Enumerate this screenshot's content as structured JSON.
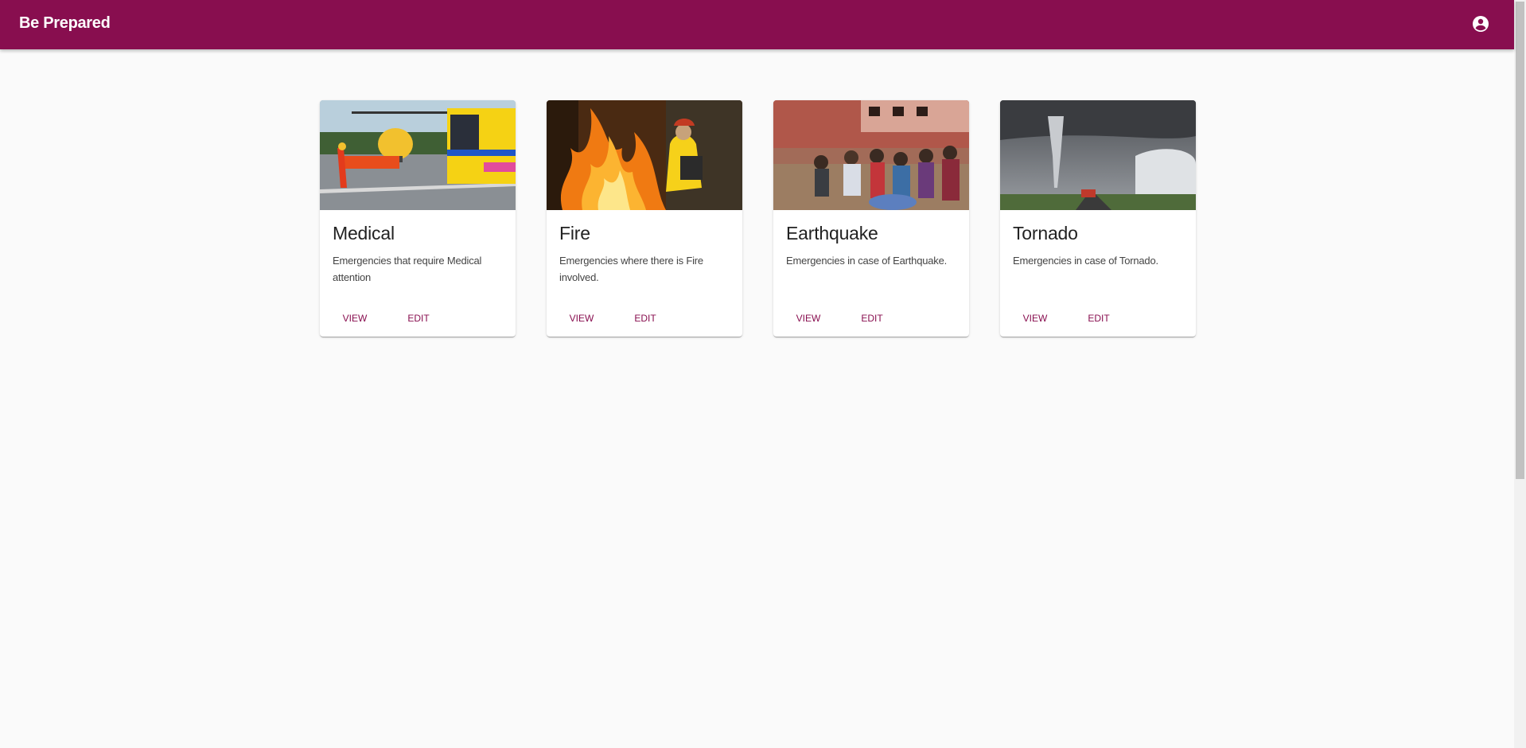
{
  "app": {
    "title": "Be Prepared",
    "account_icon": "account-circle-icon",
    "brand_color": "#880e4f",
    "background_color": "#fafafa"
  },
  "cards": [
    {
      "title": "Medical",
      "description": "Emergencies that require Medical attention",
      "image": "medical-helicopter-ambulance-image",
      "view_label": "VIEW",
      "edit_label": "EDIT"
    },
    {
      "title": "Fire",
      "description": "Emergencies where there is Fire involved.",
      "image": "firefighter-wildfire-image",
      "view_label": "VIEW",
      "edit_label": "EDIT"
    },
    {
      "title": "Earthquake",
      "description": "Emergencies in case of Earthquake.",
      "image": "earthquake-rubble-crowd-image",
      "view_label": "VIEW",
      "edit_label": "EDIT"
    },
    {
      "title": "Tornado",
      "description": "Emergencies in case of Tornado.",
      "image": "tornado-road-image",
      "view_label": "VIEW",
      "edit_label": "EDIT"
    }
  ]
}
